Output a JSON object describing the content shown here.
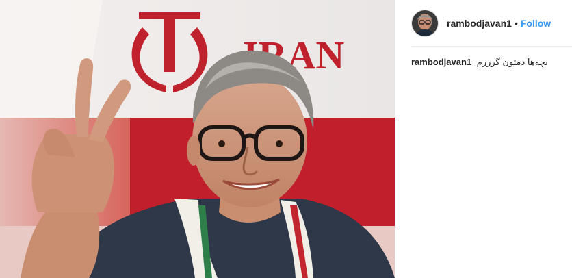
{
  "post": {
    "image_alt": "man in glasses making a V sign in front of a flag",
    "flag_text": "IRAN"
  },
  "header": {
    "username": "rambodjavan1",
    "separator": "•",
    "follow_label": "Follow"
  },
  "caption": {
    "username": "rambodjavan1",
    "text": "بچه‌ها دمتون گرررم"
  },
  "colors": {
    "link": "#3897f0",
    "text": "#262626",
    "divider": "#efefef",
    "flag_red": "#c0222d"
  },
  "icons": {
    "avatar": "profile-photo"
  }
}
